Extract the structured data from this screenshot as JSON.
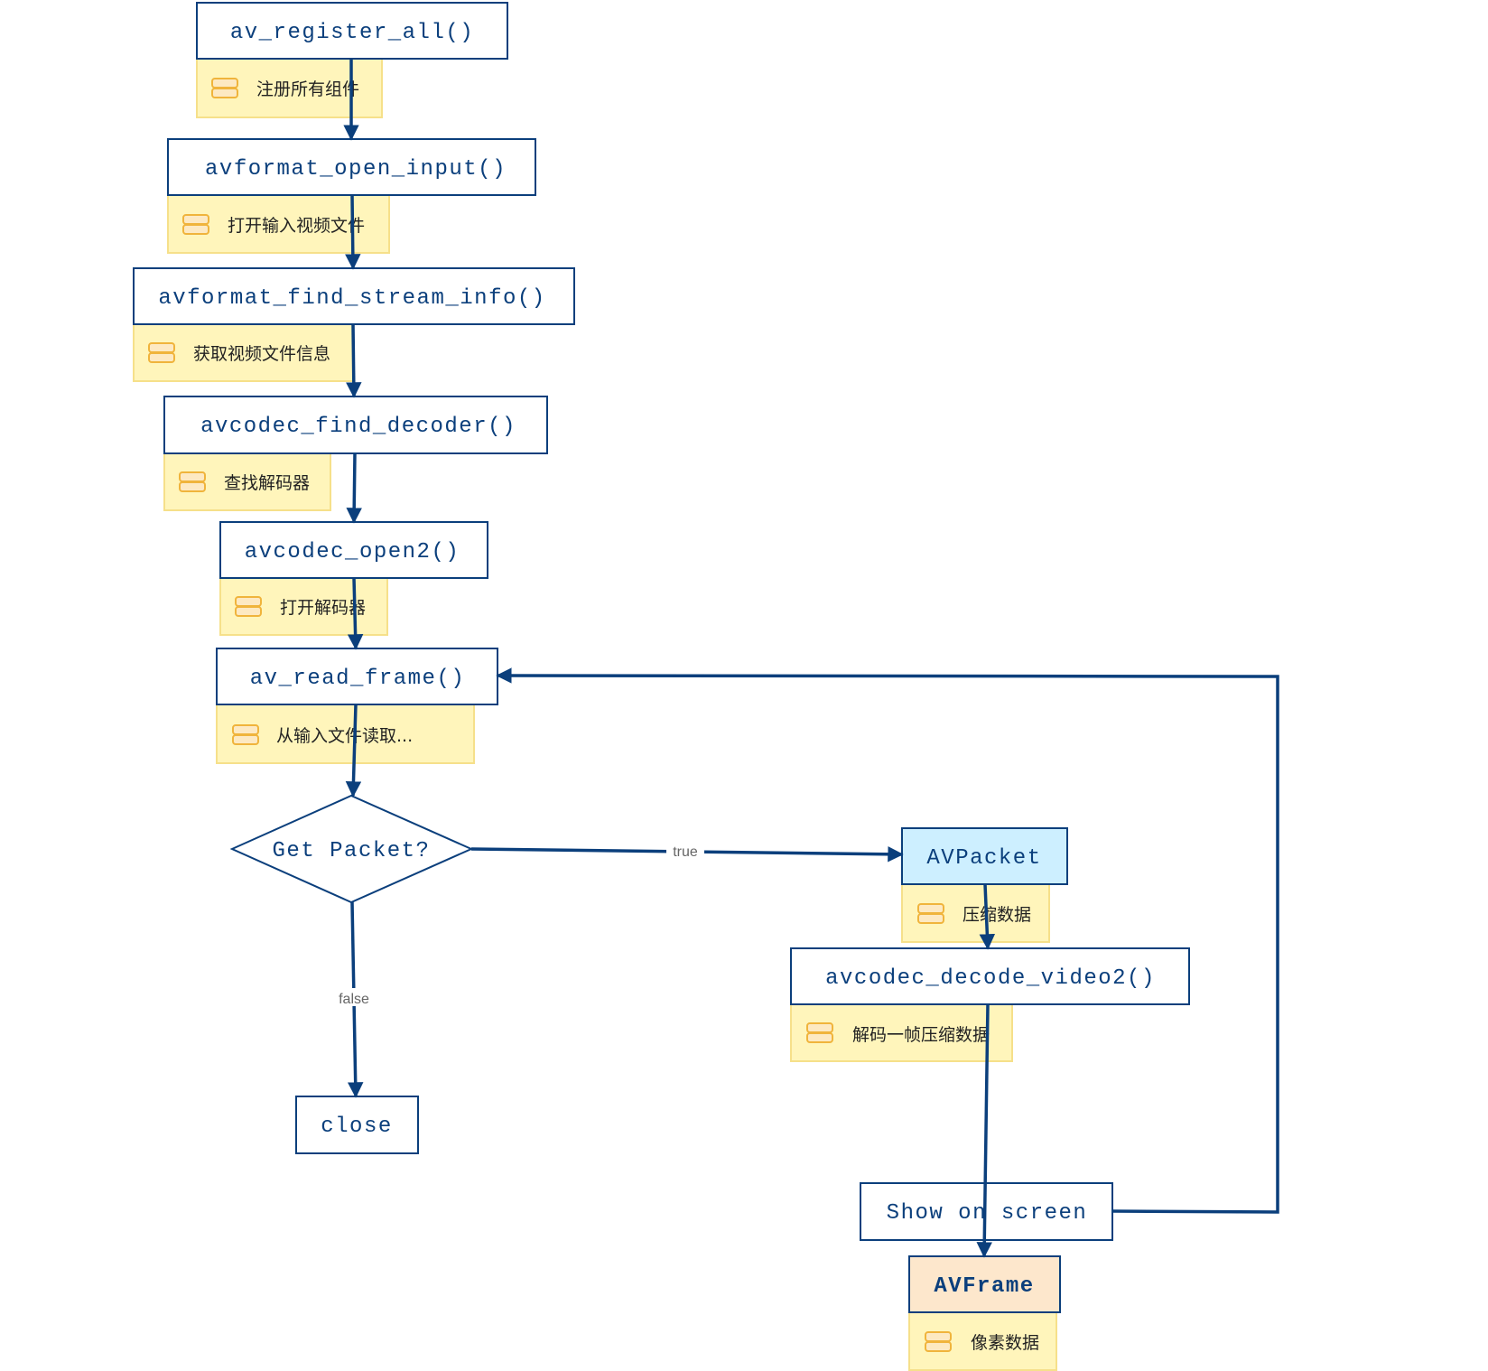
{
  "colors": {
    "line": "#0b3f7c",
    "note_fill": "#fff5bb",
    "packet_fill": "#cdefff",
    "frame_fill": "#fde7cc"
  },
  "nodes": {
    "register": {
      "label": "av_register_all()",
      "note": "注册所有组件"
    },
    "open_input": {
      "label": "avformat_open_input()",
      "note": "打开输入视频文件"
    },
    "find_stream": {
      "label": "avformat_find_stream_info()",
      "note": "获取视频文件信息"
    },
    "find_decoder": {
      "label": "avcodec_find_decoder()",
      "note": "查找解码器"
    },
    "open2": {
      "label": "avcodec_open2()",
      "note": "打开解码器"
    },
    "read_frame": {
      "label": "av_read_frame()",
      "note": "从输入文件读取..."
    },
    "decision": {
      "label": "Get Packet?"
    },
    "close": {
      "label": "close"
    },
    "packet": {
      "label": "AVPacket",
      "note": "压缩数据"
    },
    "decode": {
      "label": "avcodec_decode_video2()",
      "note": "解码一帧压缩数据"
    },
    "show": {
      "label": "Show on screen"
    },
    "frame": {
      "label": "AVFrame",
      "note": "像素数据"
    }
  },
  "edges": {
    "true_label": "true",
    "false_label": "false"
  },
  "note_icon": "storage-icon"
}
